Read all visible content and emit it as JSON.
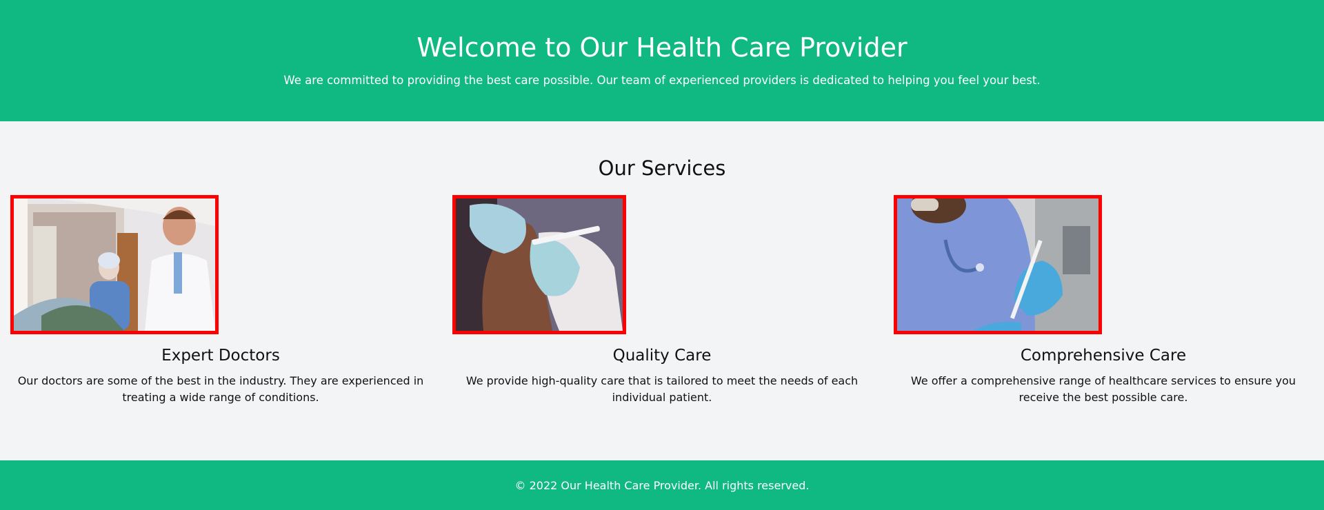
{
  "hero": {
    "title": "Welcome to Our Health Care Provider",
    "subtitle": "We are committed to providing the best care possible. Our team of experienced providers is dedicated to helping you feel your best."
  },
  "services": {
    "heading": "Our Services",
    "items": [
      {
        "title": "Expert Doctors",
        "description": "Our doctors are some of the best in the industry. They are experienced in treating a wide range of conditions.",
        "image": "doctor-and-nurse-with-patient-photo"
      },
      {
        "title": "Quality Care",
        "description": "We provide high-quality care that is tailored to meet the needs of each individual patient.",
        "image": "vaccine-injection-photo"
      },
      {
        "title": "Comprehensive Care",
        "description": "We offer a comprehensive range of healthcare services to ensure you receive the best possible care.",
        "image": "clinician-with-syringe-photo"
      }
    ]
  },
  "footer": {
    "copyright": "© 2022 Our Health Care Provider. All rights reserved."
  },
  "colors": {
    "brand_green": "#10b981",
    "page_background": "#f3f4f6",
    "image_border": "#ff0000"
  }
}
